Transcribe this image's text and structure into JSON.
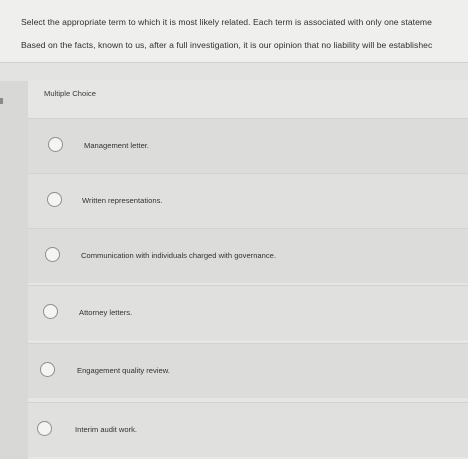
{
  "question": {
    "line1": "Select the appropriate term to which it is most likely related. Each term is associated with only one stateme",
    "line2": "Based on the facts, known to us, after a full investigation, it is our opinion that no liability will be establishec"
  },
  "multiple_choice": {
    "label": "Multiple Choice",
    "options": [
      {
        "label": "Management letter."
      },
      {
        "label": "Written representations."
      },
      {
        "label": "Communication with individuals charged with governance."
      },
      {
        "label": "Attorney letters."
      },
      {
        "label": "Engagement quality review."
      },
      {
        "label": "Interim audit work."
      }
    ]
  }
}
